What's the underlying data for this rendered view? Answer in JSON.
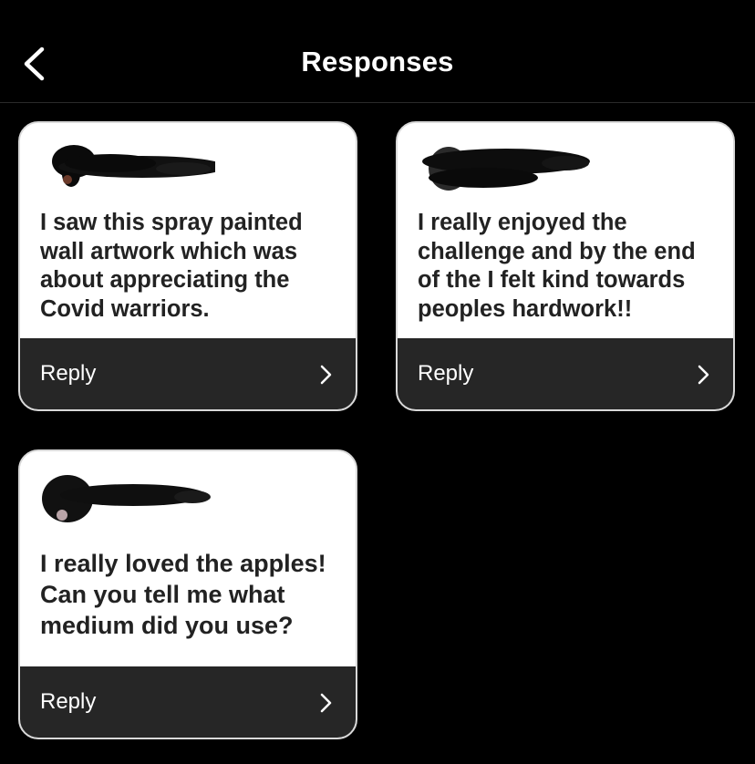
{
  "header": {
    "title": "Responses",
    "back_icon": "chevron-left-icon"
  },
  "responses": [
    {
      "text": "I saw this spray painted wall artwork which was about appreciating the Covid warriors.",
      "reply_label": "Reply",
      "reply_icon": "chevron-right-icon"
    },
    {
      "text": "I really enjoyed the challenge and by the end of the I felt kind towards peoples hardwork!!",
      "reply_label": "Reply",
      "reply_icon": "chevron-right-icon"
    },
    {
      "text": "I really loved the apples! Can you tell me what medium did you use?",
      "reply_label": "Reply",
      "reply_icon": "chevron-right-icon"
    }
  ],
  "colors": {
    "background": "#000000",
    "card": "#ffffff",
    "footer": "#262626",
    "text": "#222222"
  }
}
